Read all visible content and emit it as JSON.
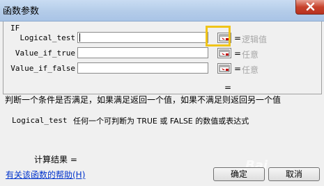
{
  "window": {
    "title": "函数参数"
  },
  "function": {
    "name": "IF"
  },
  "arguments": [
    {
      "label": "Logical_test",
      "value": "",
      "hint": "逻辑值"
    },
    {
      "label": "Value_if_true",
      "value": "",
      "hint": "任意"
    },
    {
      "label": "Value_if_false",
      "value": "",
      "hint": "任意"
    }
  ],
  "equals_sign": "=",
  "description": "判断一个条件是否满足，如果满足返回一个值，如果不满足则返回另一个值",
  "param_help": {
    "name": "Logical_test",
    "text": "任何一个可判断为 TRUE 或 FALSE 的数值或表达式"
  },
  "result": {
    "label": "计算结果 ="
  },
  "help_link": "有关该函数的帮助(H)",
  "buttons": {
    "ok": "确定",
    "cancel": "取消"
  },
  "watermark": "Bai"
}
